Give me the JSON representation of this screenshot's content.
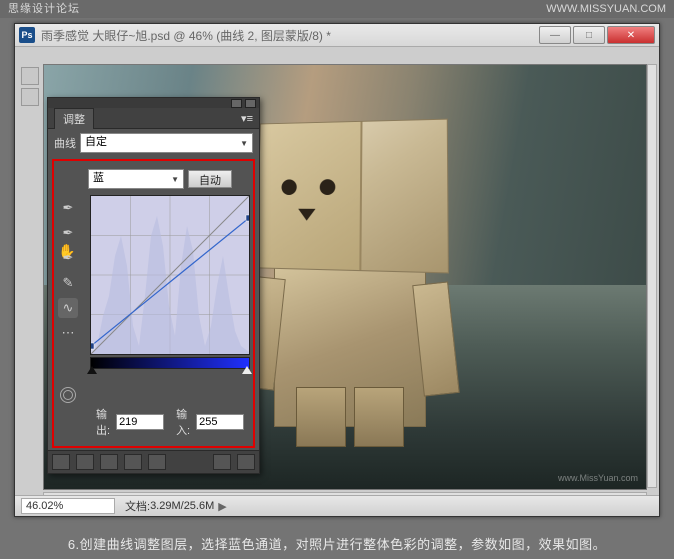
{
  "header": {
    "left": "思缘设计论坛",
    "right": "WWW.MISSYUAN.COM"
  },
  "window": {
    "title": "雨季感觉  大眼仔~旭.psd @ 46% (曲线 2, 图层蒙版/8) *",
    "btn_min": "—",
    "btn_max": "□",
    "btn_close": "✕"
  },
  "panel": {
    "tab": "调整",
    "menu": "▾≡",
    "preset_label": "曲线",
    "preset_value": "自定",
    "channel_value": "蓝",
    "auto": "自动",
    "output_label": "输出:",
    "output_value": "219",
    "input_label": "输入:",
    "input_value": "255"
  },
  "status": {
    "zoom": "46.02%",
    "doc_label": "文档:",
    "doc_value": "3.29M/25.6M",
    "arr": "▶"
  },
  "caption": "6.创建曲线调整图层，选择蓝色通道，对照片进行整体色彩的调整，参数如图，效果如图。",
  "watermark": "www.MissYuan.com",
  "chart_data": {
    "type": "line",
    "title": "Curves — Blue channel",
    "xlabel": "Input",
    "ylabel": "Output",
    "xlim": [
      0,
      255
    ],
    "ylim": [
      0,
      255
    ],
    "series": [
      {
        "name": "Blue",
        "points": [
          [
            0,
            13
          ],
          [
            255,
            219
          ]
        ]
      }
    ],
    "annotations": {
      "output": 219,
      "input": 255
    }
  }
}
